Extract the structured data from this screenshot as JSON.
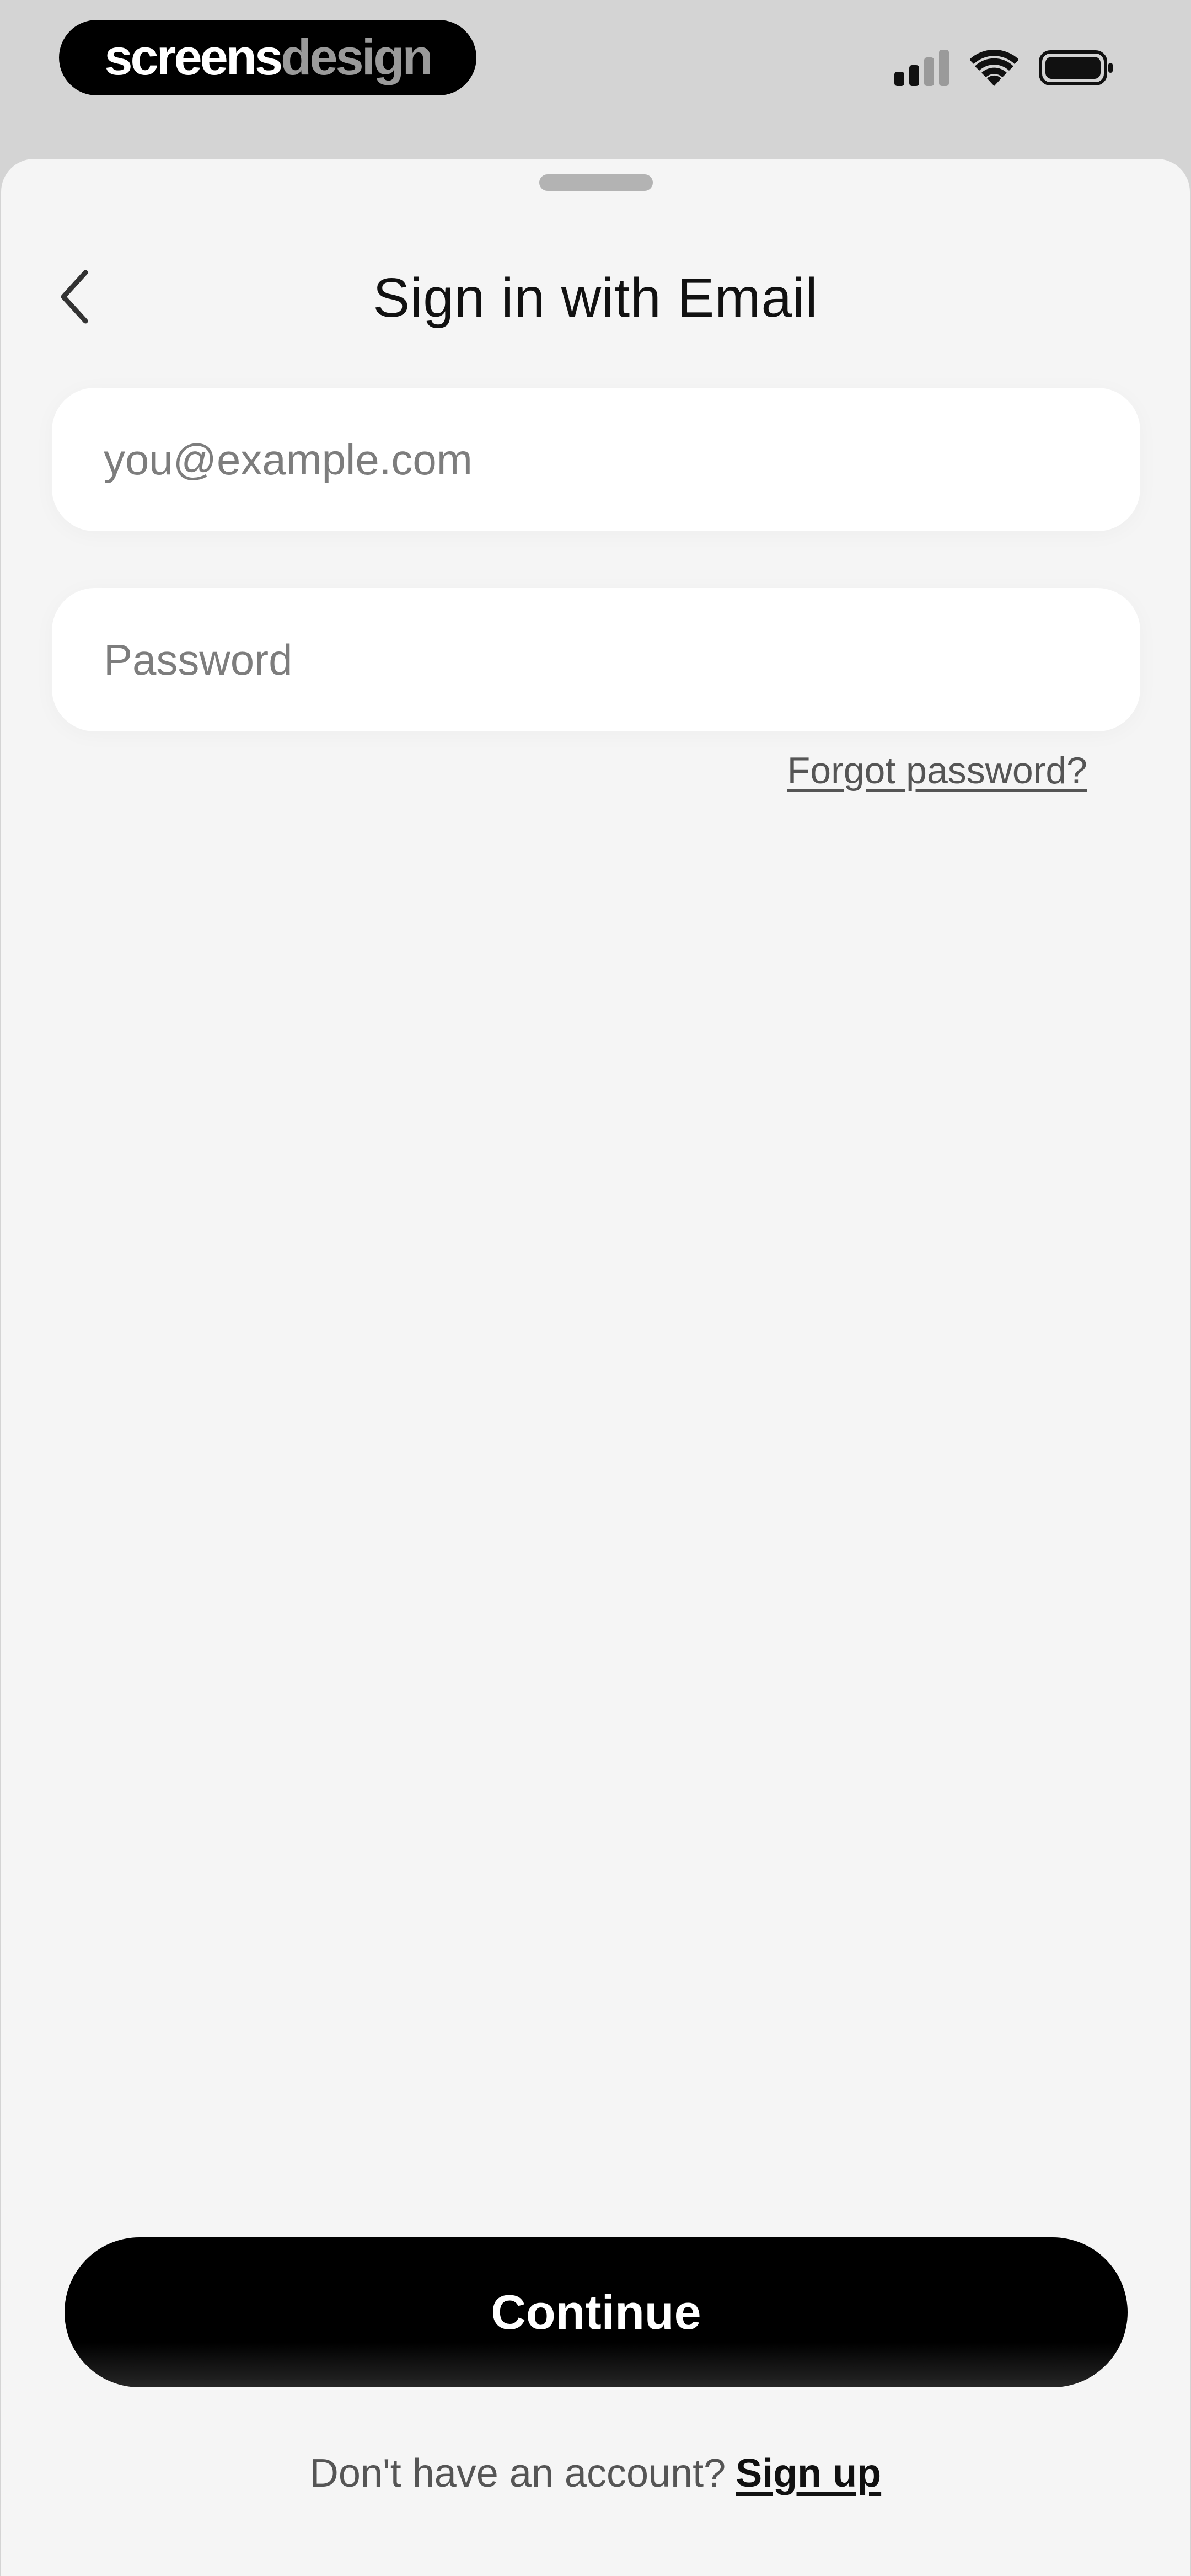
{
  "status_bar": {
    "brand_part1": "screens",
    "brand_part2": "design",
    "icons": [
      "signal-icon",
      "wifi-icon",
      "battery-icon"
    ]
  },
  "header": {
    "back_icon": "chevron-left-icon",
    "title": "Sign in with Email"
  },
  "form": {
    "email_placeholder": "you@example.com",
    "email_value": "",
    "password_placeholder": "Password",
    "password_value": "",
    "forgot_label": "Forgot password?"
  },
  "actions": {
    "continue_label": "Continue"
  },
  "footer": {
    "prompt": "Don't have an account?",
    "signup_label": "Sign up"
  },
  "colors": {
    "background": "#f5f5f5",
    "button": "#000000",
    "button_text": "#ffffff"
  }
}
